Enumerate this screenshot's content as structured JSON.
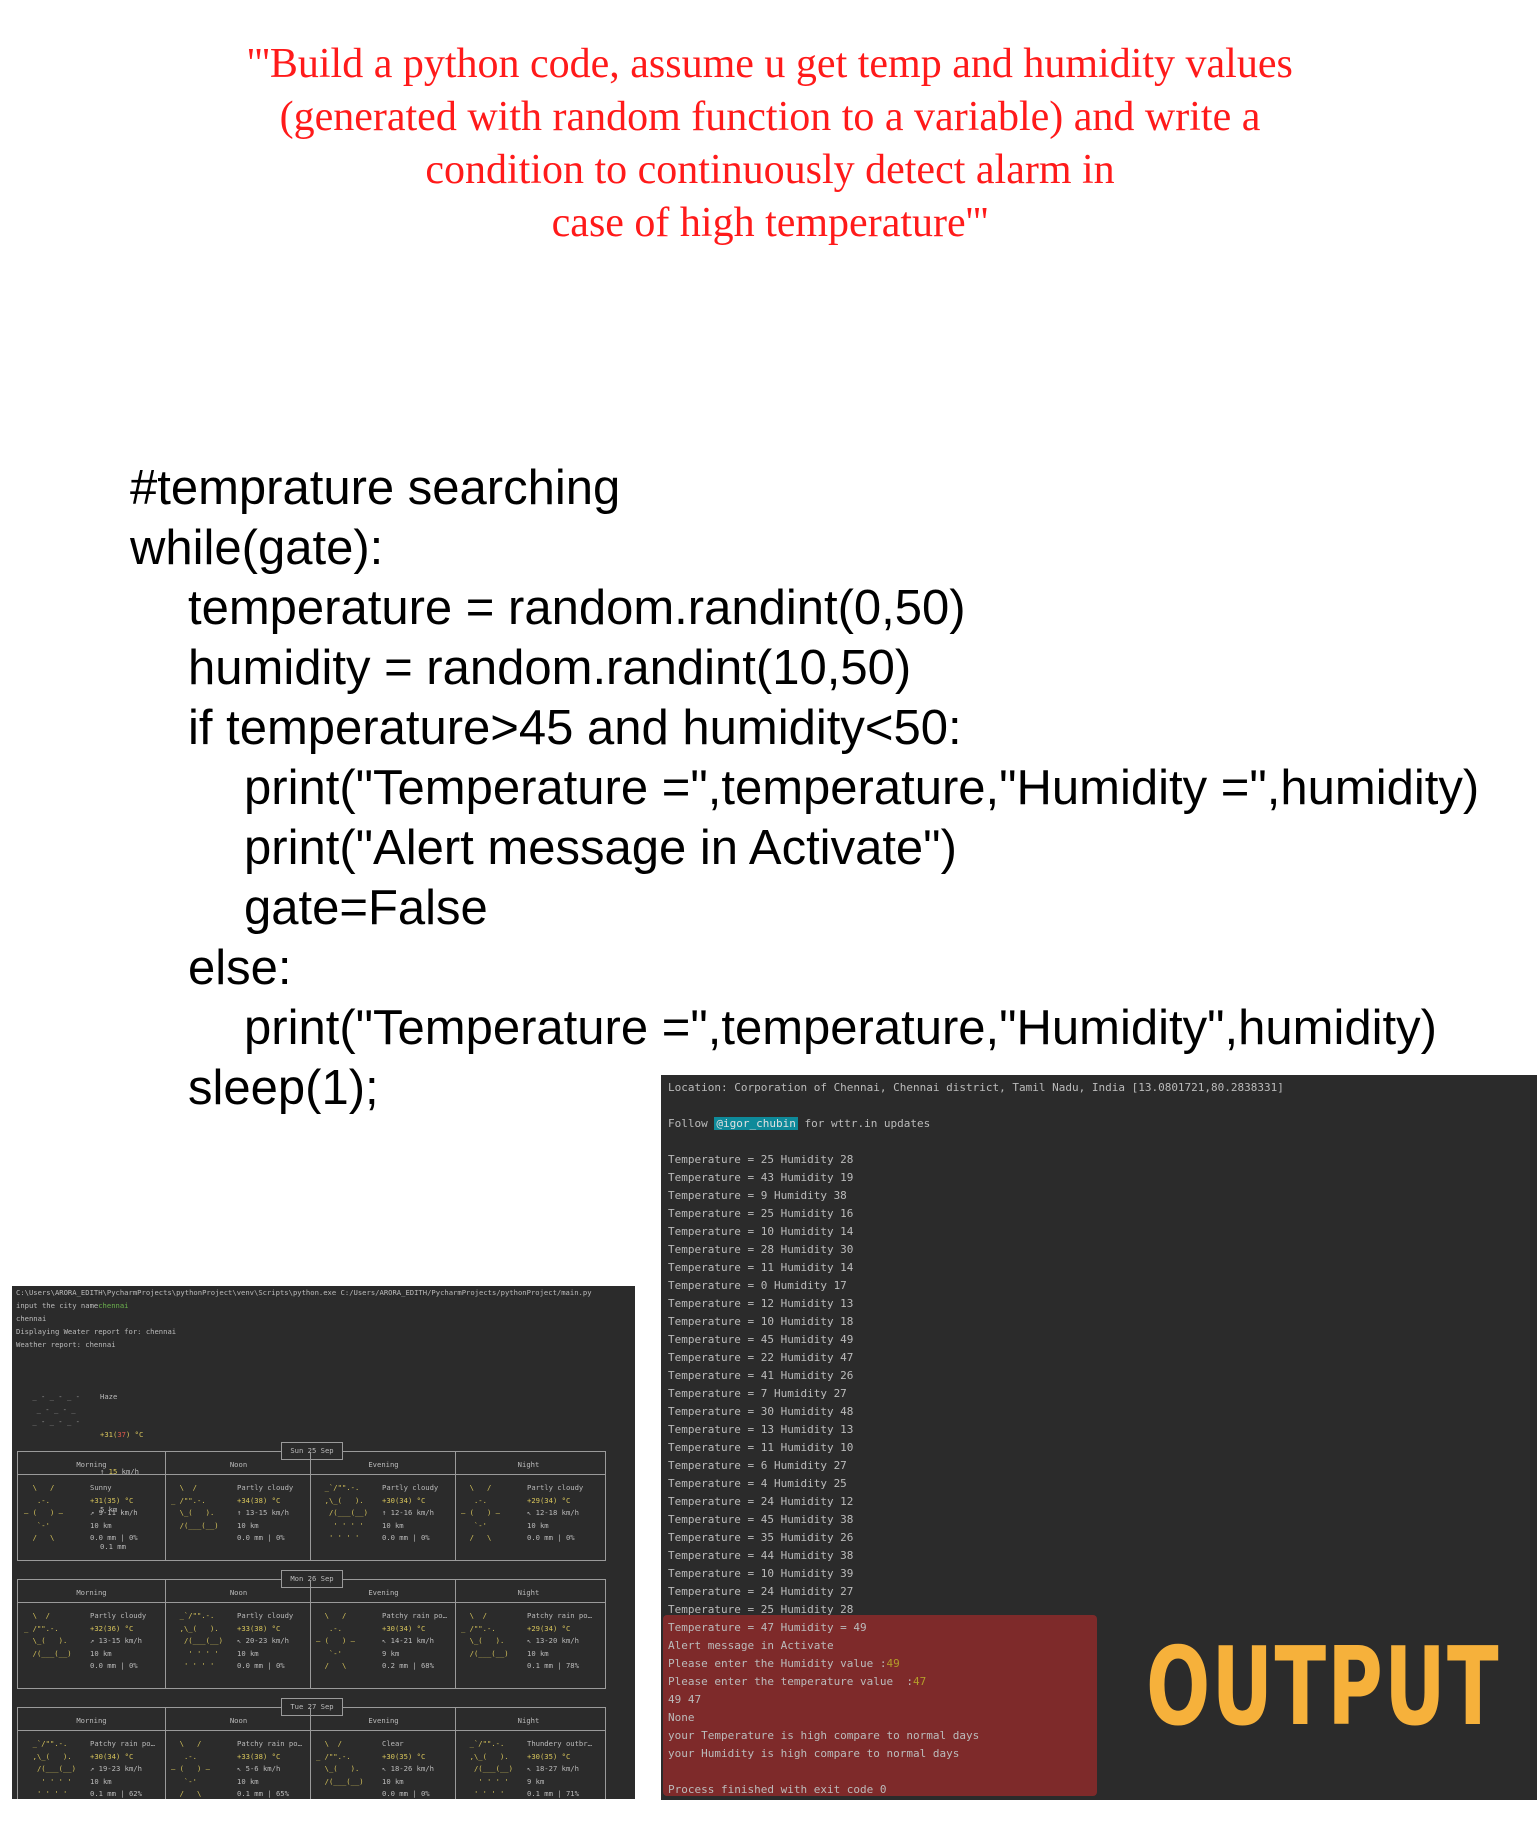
{
  "prompt_lines": [
    "'''Build a python code, assume u get temp and humidity values",
    "(generated with random function to a variable) and write a",
    "condition to continuously detect alarm in",
    "case of high temperature'''"
  ],
  "code_lines": [
    {
      "indent": 0,
      "text": "#temprature searching"
    },
    {
      "indent": 0,
      "text": "while(gate):"
    },
    {
      "indent": 1,
      "text": "temperature = random.randint(0,50)"
    },
    {
      "indent": 1,
      "text": "humidity = random.randint(10,50)"
    },
    {
      "indent": 1,
      "text": "if temperature>45 and humidity<50:"
    },
    {
      "indent": 2,
      "text": "print(\"Temperature =\",temperature,\"Humidity =\",humidity)"
    },
    {
      "indent": 2,
      "text": "print(\"Alert message in Activate\")"
    },
    {
      "indent": 2,
      "text": "gate=False"
    },
    {
      "indent": 1,
      "text": "else:"
    },
    {
      "indent": 2,
      "text": "print(\"Temperature =\",temperature,\"Humidity\",humidity)"
    },
    {
      "indent": 1,
      "text": "sleep(1);"
    }
  ],
  "weather_console": {
    "cmd": "C:\\Users\\ARORA_EDITH\\PycharmProjects\\pythonProject\\venv\\Scripts\\python.exe C:/Users/ARORA_EDITH/PycharmProjects/pythonProject/main.py",
    "prompt_label": "input the city name",
    "prompt_input": "chennai",
    "echo": "chennai",
    "displaying": "Displaying Weater report for: chennai",
    "report_label": "Weather report: chennai",
    "current": {
      "condition": "Haze",
      "temp_prefix": "+31(",
      "temp_feels": "37",
      "temp_suffix": ") °C",
      "wind_arrow": "↑",
      "wind_speed": "15",
      "wind_unit": "km/h",
      "visibility": "5 km",
      "precip": "0.1 mm"
    },
    "periods": [
      "Morning",
      "Noon",
      "Evening",
      "Night"
    ],
    "days": [
      {
        "date": "Sun 25 Sep",
        "cells": [
          {
            "cond": "Sunny",
            "temp": "+31(35) °C",
            "wind": "↗ 9-11 km/h",
            "vis": "10 km",
            "rain": "0.0 mm | 0%"
          },
          {
            "cond": "Partly cloudy",
            "temp": "+34(38) °C",
            "wind": "↑ 13-15 km/h",
            "vis": "10 km",
            "rain": "0.0 mm | 0%"
          },
          {
            "cond": "Partly cloudy",
            "temp": "+30(34) °C",
            "wind": "↑ 12-16 km/h",
            "vis": "10 km",
            "rain": "0.0 mm | 0%"
          },
          {
            "cond": "Partly cloudy",
            "temp": "+29(34) °C",
            "wind": "↖ 12-18 km/h",
            "vis": "10 km",
            "rain": "0.0 mm | 0%"
          }
        ]
      },
      {
        "date": "Mon 26 Sep",
        "cells": [
          {
            "cond": "Partly cloudy",
            "temp": "+32(36) °C",
            "wind": "↗ 13-15 km/h",
            "vis": "10 km",
            "rain": "0.0 mm | 0%"
          },
          {
            "cond": "Partly cloudy",
            "temp": "+33(38) °C",
            "wind": "↖ 20-23 km/h",
            "vis": "10 km",
            "rain": "0.0 mm | 0%"
          },
          {
            "cond": "Patchy rain po…",
            "temp": "+30(34) °C",
            "wind": "↖ 14-21 km/h",
            "vis": "9 km",
            "rain": "0.2 mm | 68%"
          },
          {
            "cond": "Patchy rain po…",
            "temp": "+29(34) °C",
            "wind": "↖ 13-20 km/h",
            "vis": "10 km",
            "rain": "0.1 mm | 78%"
          }
        ]
      },
      {
        "date": "Tue 27 Sep",
        "cells": [
          {
            "cond": "Patchy rain po…",
            "temp": "+30(34) °C",
            "wind": "↗ 19-23 km/h",
            "vis": "10 km",
            "rain": "0.1 mm | 62%"
          },
          {
            "cond": "Patchy rain po…",
            "temp": "+33(38) °C",
            "wind": "↖ 5-6 km/h",
            "vis": "10 km",
            "rain": "0.1 mm | 65%"
          },
          {
            "cond": "Clear",
            "temp": "+30(35) °C",
            "wind": "↖ 18-26 km/h",
            "vis": "10 km",
            "rain": "0.0 mm | 0%"
          },
          {
            "cond": "Thundery outbr…",
            "temp": "+30(35) °C",
            "wind": "↖ 18-27 km/h",
            "vis": "9 km",
            "rain": "0.1 mm | 71%"
          }
        ]
      }
    ]
  },
  "output_console": {
    "location": "Location: Corporation of Chennai, Chennai district, Tamil Nadu, India [13.0801721,80.2838331]",
    "follow_prefix": "Follow ",
    "follow_handle": "@igor_chubin",
    "follow_suffix": " for wttr.in updates",
    "readings": [
      "Temperature = 25 Humidity 28",
      "Temperature = 43 Humidity 19",
      "Temperature = 9 Humidity 38",
      "Temperature = 25 Humidity 16",
      "Temperature = 10 Humidity 14",
      "Temperature = 28 Humidity 30",
      "Temperature = 11 Humidity 14",
      "Temperature = 0 Humidity 17",
      "Temperature = 12 Humidity 13",
      "Temperature = 10 Humidity 18",
      "Temperature = 45 Humidity 49",
      "Temperature = 22 Humidity 47",
      "Temperature = 41 Humidity 26",
      "Temperature = 7 Humidity 27",
      "Temperature = 30 Humidity 48",
      "Temperature = 13 Humidity 13",
      "Temperature = 11 Humidity 10",
      "Temperature = 6 Humidity 27",
      "Temperature = 4 Humidity 25",
      "Temperature = 24 Humidity 12",
      "Temperature = 45 Humidity 38",
      "Temperature = 35 Humidity 26",
      "Temperature = 44 Humidity 38",
      "Temperature = 10 Humidity 39",
      "Temperature = 24 Humidity 27",
      "Temperature = 25 Humidity 28"
    ],
    "alert_reading": "Temperature = 47 Humidity = 49",
    "alert_message": "Alert message in Activate",
    "humidity_prompt": "Please enter the Humidity value :",
    "humidity_input": "49",
    "temp_prompt": "Please enter the temperature value  :",
    "temp_input": "47",
    "values_echo": "49 47",
    "none_line": "None",
    "temp_high": "your Temperature is high compare to normal days",
    "humidity_high": "your Humidity is high compare to normal days",
    "exit_line": "Process finished with exit code 0",
    "label": "OUTPUT"
  }
}
